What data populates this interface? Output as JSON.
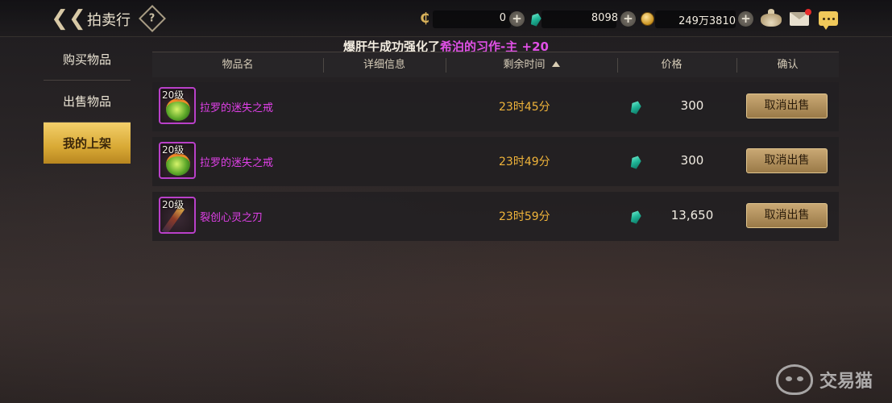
{
  "header": {
    "title": "拍卖行",
    "help_icon": "?",
    "currencies": [
      {
        "name": "c-coin-icon",
        "value": "0"
      },
      {
        "name": "gem-icon",
        "value": "8098"
      },
      {
        "name": "gold-coin-icon",
        "value": "249万3810"
      }
    ]
  },
  "broadcast": {
    "prefix": "爆肝牛成功强化了",
    "highlight": "希泊的习作-主",
    "suffix": " +20"
  },
  "sidebar": {
    "items": [
      {
        "label": "购买物品",
        "active": false
      },
      {
        "label": "出售物品",
        "active": false
      },
      {
        "label": "我的上架",
        "active": true
      }
    ]
  },
  "table": {
    "columns": [
      "物品名",
      "详细信息",
      "剩余时间",
      "价格",
      "确认"
    ],
    "sorted_column": "剩余时间",
    "rows": [
      {
        "level": "20级",
        "name": "拉罗的迷失之戒",
        "time": "23时45分",
        "price": "300",
        "action": "取消出售",
        "icon": "ring-icon"
      },
      {
        "level": "20级",
        "name": "拉罗的迷失之戒",
        "time": "23时49分",
        "price": "300",
        "action": "取消出售",
        "icon": "ring-icon"
      },
      {
        "level": "20级",
        "name": "裂创心灵之刃",
        "time": "23时59分",
        "price": "13,650",
        "action": "取消出售",
        "icon": "blade-icon"
      }
    ]
  },
  "watermark": {
    "text": "交易猫"
  },
  "colors": {
    "accent_gold": "#d8a935",
    "item_name": "#e040e8",
    "time": "#f0b43a",
    "highlight": "#e050e6"
  }
}
